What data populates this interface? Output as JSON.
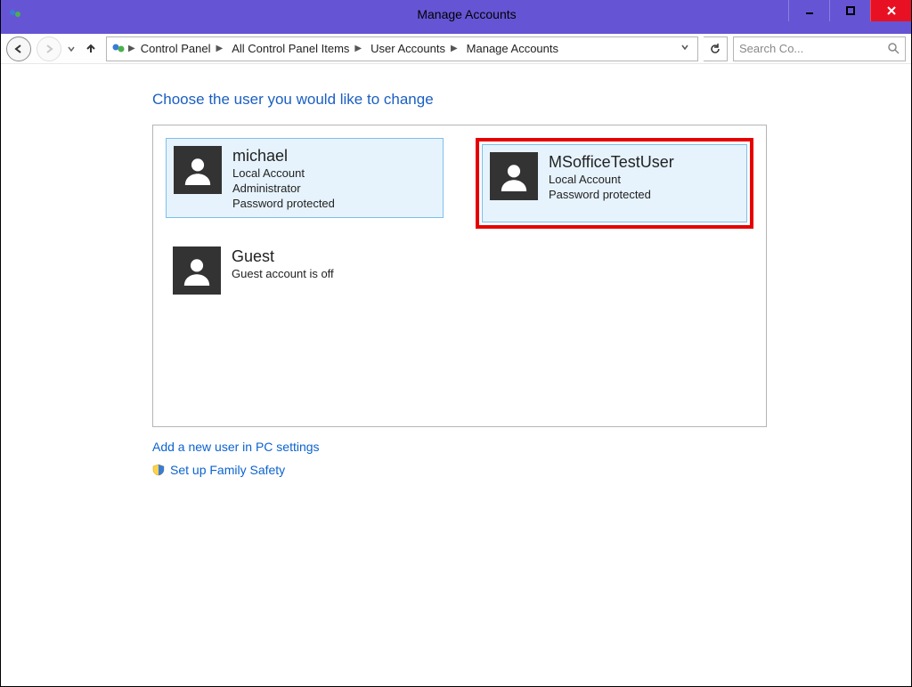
{
  "window": {
    "title": "Manage Accounts"
  },
  "breadcrumb": {
    "items": [
      "Control Panel",
      "All Control Panel Items",
      "User Accounts",
      "Manage Accounts"
    ]
  },
  "search": {
    "placeholder": "Search Co..."
  },
  "page": {
    "heading": "Choose the user you would like to change"
  },
  "accounts": [
    {
      "name": "michael",
      "type": "Local Account",
      "role": "Administrator",
      "pw": "Password protected",
      "state": "selected"
    },
    {
      "name": "MSofficeTestUser",
      "type": "Local Account",
      "pw": "Password protected",
      "state": "highlighted"
    },
    {
      "name": "Guest",
      "status": "Guest account is off",
      "state": "plain"
    }
  ],
  "links": {
    "add_user": "Add a new user in PC settings",
    "family_safety": "Set up Family Safety"
  }
}
